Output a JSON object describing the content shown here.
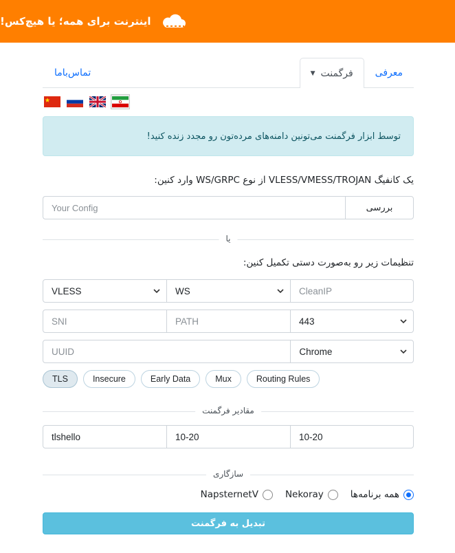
{
  "header": {
    "title": "اینترنت برای همه؛ یا هیچ‌کس!",
    "icon": "cloud-icon",
    "background": "#ff7f00"
  },
  "tabs": {
    "intro": "معرفی",
    "fragment": "فرگمنت",
    "contact": "تماس‌باما"
  },
  "flags": [
    "iran-flag-icon",
    "uk-flag-icon",
    "russia-flag-icon",
    "china-flag-icon"
  ],
  "alert": {
    "text": "توسط ابزار فرگمنت می‌تونین دامنه‌های مرده‌تون رو مجدد زنده کنید!"
  },
  "config": {
    "label": "یک کانفیگ VLESS/VMESS/TROJAN از نوع WS/GRPC وارد کنین:",
    "placeholder": "Your Config",
    "check_button": "بررسی"
  },
  "or_label": "یا",
  "manual": {
    "label": "تنظیمات زیر رو به‌صورت دستی تکمیل کنین:",
    "protocol": "VLESS",
    "transport": "WS",
    "cleanip_placeholder": "CleanIP",
    "sni_placeholder": "SNI",
    "path_placeholder": "PATH",
    "port": "443",
    "uuid_placeholder": "UUID",
    "fingerprint": "Chrome"
  },
  "options": [
    "TLS",
    "Insecure",
    "Early Data",
    "Mux",
    "Routing Rules"
  ],
  "fragment_values": {
    "label": "مقادیر فرگمنت",
    "packets": "tlshello",
    "length": "10-20",
    "interval": "10-20"
  },
  "compat": {
    "label": "سازگاری",
    "all_apps": "همه برنامه‌ها",
    "nekoray": "Nekoray",
    "napsternetv": "NapsternetV",
    "selected": "all_apps"
  },
  "convert_button": "تبدیل به فرگمنت"
}
